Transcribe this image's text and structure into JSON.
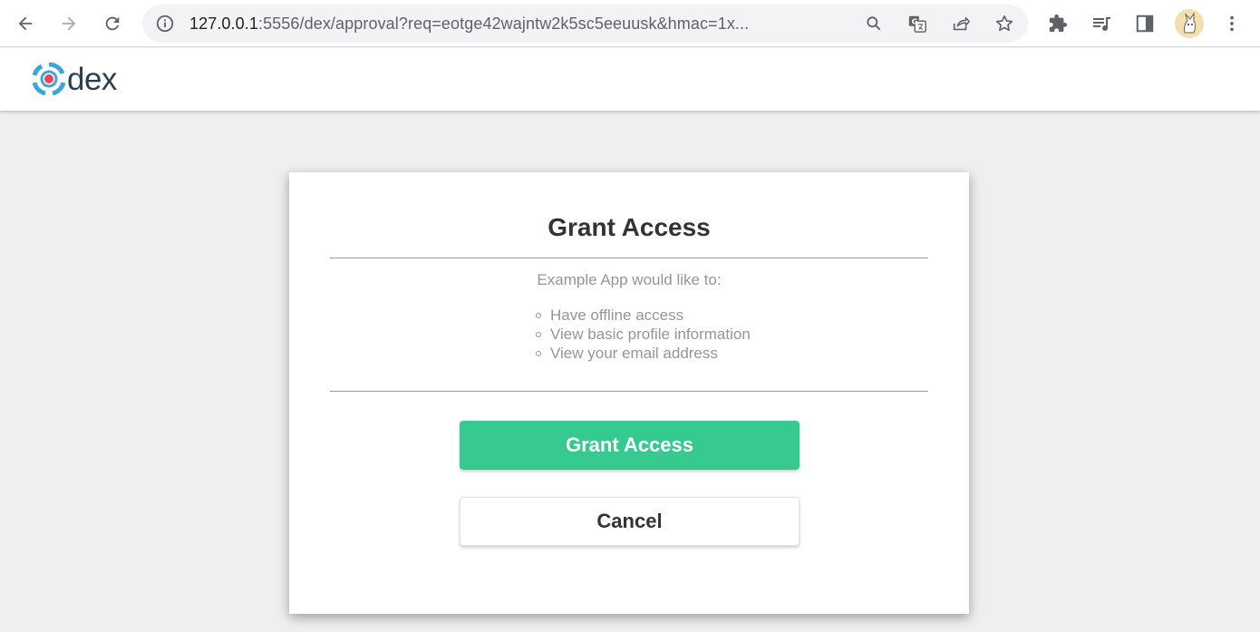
{
  "browser": {
    "url_host": "127.0.0.1",
    "url_rest": ":5556/dex/approval?req=eotge42wajntw2k5sc5eeuusk&hmac=1x..."
  },
  "site": {
    "logo_text": "dex",
    "brand_colors": {
      "blue": "#3ba6dc",
      "red": "#e9474f",
      "text": "#2d3e4e"
    }
  },
  "approval": {
    "title": "Grant Access",
    "intro": "Example App would like to:",
    "scopes": [
      "Have offline access",
      "View basic profile information",
      "View your email address"
    ],
    "grant_label": "Grant Access",
    "cancel_label": "Cancel",
    "grant_color": "#36c990"
  }
}
